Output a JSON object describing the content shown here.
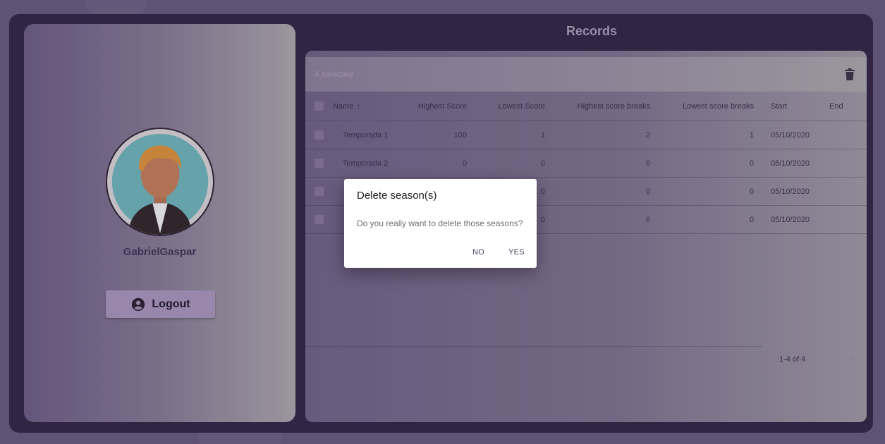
{
  "profile": {
    "username": "GabrielGaspar",
    "logout_label": "Logout"
  },
  "records": {
    "title": "Records",
    "selected_text": "4 selected",
    "columns": {
      "name": "Name",
      "highest_score": "Highest Score",
      "lowest_score": "Lowest Score",
      "highest_breaks": "Highest score breaks",
      "lowest_breaks": "Lowest score breaks",
      "start": "Start",
      "end": "End"
    },
    "sort_icon": "↑",
    "rows": [
      {
        "name": "Temporada 1",
        "highest_score": "100",
        "lowest_score": "1",
        "highest_breaks": "2",
        "lowest_breaks": "1",
        "start": "05/10/2020",
        "end": ""
      },
      {
        "name": "Temporada 2",
        "highest_score": "0",
        "lowest_score": "0",
        "highest_breaks": "0",
        "lowest_breaks": "0",
        "start": "05/10/2020",
        "end": ""
      },
      {
        "name": "",
        "highest_score": "",
        "lowest_score": "0",
        "highest_breaks": "0",
        "lowest_breaks": "0",
        "start": "05/10/2020",
        "end": ""
      },
      {
        "name": "",
        "highest_score": "",
        "lowest_score": "0",
        "highest_breaks": "0",
        "lowest_breaks": "0",
        "start": "05/10/2020",
        "end": ""
      }
    ],
    "pagination": "1-4 of 4",
    "prev_icon": "‹",
    "next_icon": "›"
  },
  "dialog": {
    "title": "Delete season(s)",
    "text": "Do you really want to delete those seasons?",
    "no_label": "NO",
    "yes_label": "YES"
  },
  "colors": {
    "page_bg": "#665878",
    "frame_bg": "#302540",
    "logout_bg": "#a693b7"
  }
}
